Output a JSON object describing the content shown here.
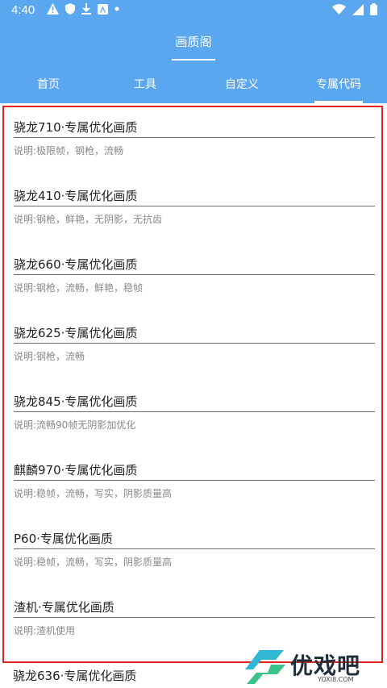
{
  "status_bar": {
    "time": "4:40"
  },
  "app": {
    "title": "画质阁"
  },
  "tabs": [
    {
      "label": "首页"
    },
    {
      "label": "工具"
    },
    {
      "label": "自定义"
    },
    {
      "label": "专属代码",
      "selected": true
    }
  ],
  "items": [
    {
      "name": "骁龙710·专属优化画质",
      "desc": "说明:极限帧，钢枪，流畅"
    },
    {
      "name": "骁龙410·专属优化画质",
      "desc": "说明:钢枪，鲜艳，无阴影，无抗齿"
    },
    {
      "name": "骁龙660·专属优化画质",
      "desc": "说明:钢枪，流畅，鲜艳，稳帧"
    },
    {
      "name": "骁龙625·专属优化画质",
      "desc": "说明:钢枪，流畅"
    },
    {
      "name": "骁龙845·专属优化画质",
      "desc": "说明:流畅90帧无阴影加优化"
    },
    {
      "name": "麒麟970·专属优化画质",
      "desc": "说明:稳帧，流畅，写实，阴影质量高"
    },
    {
      "name": "P60·专属优化画质",
      "desc": "说明:稳帧，流畅，写实，阴影质量高"
    },
    {
      "name": "渣机·专属优化画质",
      "desc": "说明:渣机使用"
    }
  ],
  "peek_item": {
    "name": "骁龙636·专属优化画质"
  },
  "watermark": {
    "text": "优戏吧",
    "url": "YOXI8.COM"
  },
  "colors": {
    "primary": "#5aa7ef",
    "highlight_border": "#e0261f"
  }
}
